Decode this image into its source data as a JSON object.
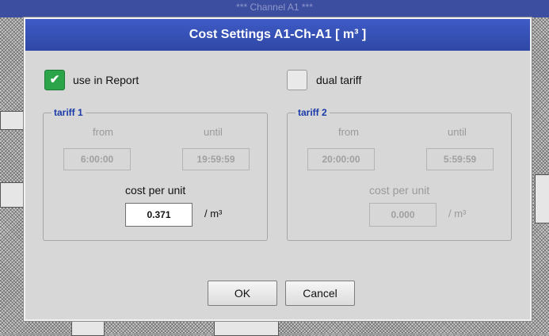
{
  "background": {
    "window_title": "*** Channel A1 ***"
  },
  "dialog": {
    "title": "Cost Settings A1-Ch-A1 [ m³ ]",
    "use_in_report": {
      "label": "use in Report",
      "checked": true,
      "check_glyph": "✔"
    },
    "dual_tariff": {
      "label": "dual tariff",
      "checked": false
    },
    "tariff1": {
      "legend": "tariff 1",
      "from_label": "from",
      "until_label": "until",
      "from_value": "6:00:00",
      "until_value": "19:59:59",
      "cost_label": "cost per unit",
      "cost_value": "0.371",
      "unit": "/ m³"
    },
    "tariff2": {
      "legend": "tariff 2",
      "from_label": "from",
      "until_label": "until",
      "from_value": "20:00:00",
      "until_value": "5:59:59",
      "cost_label": "cost per unit",
      "cost_value": "0.000",
      "unit": "/ m³"
    },
    "buttons": {
      "ok": "OK",
      "cancel": "Cancel"
    }
  },
  "colors": {
    "title_bar": "#3450b8",
    "check_on": "#2ba44a",
    "legend": "#1a3aa8"
  }
}
